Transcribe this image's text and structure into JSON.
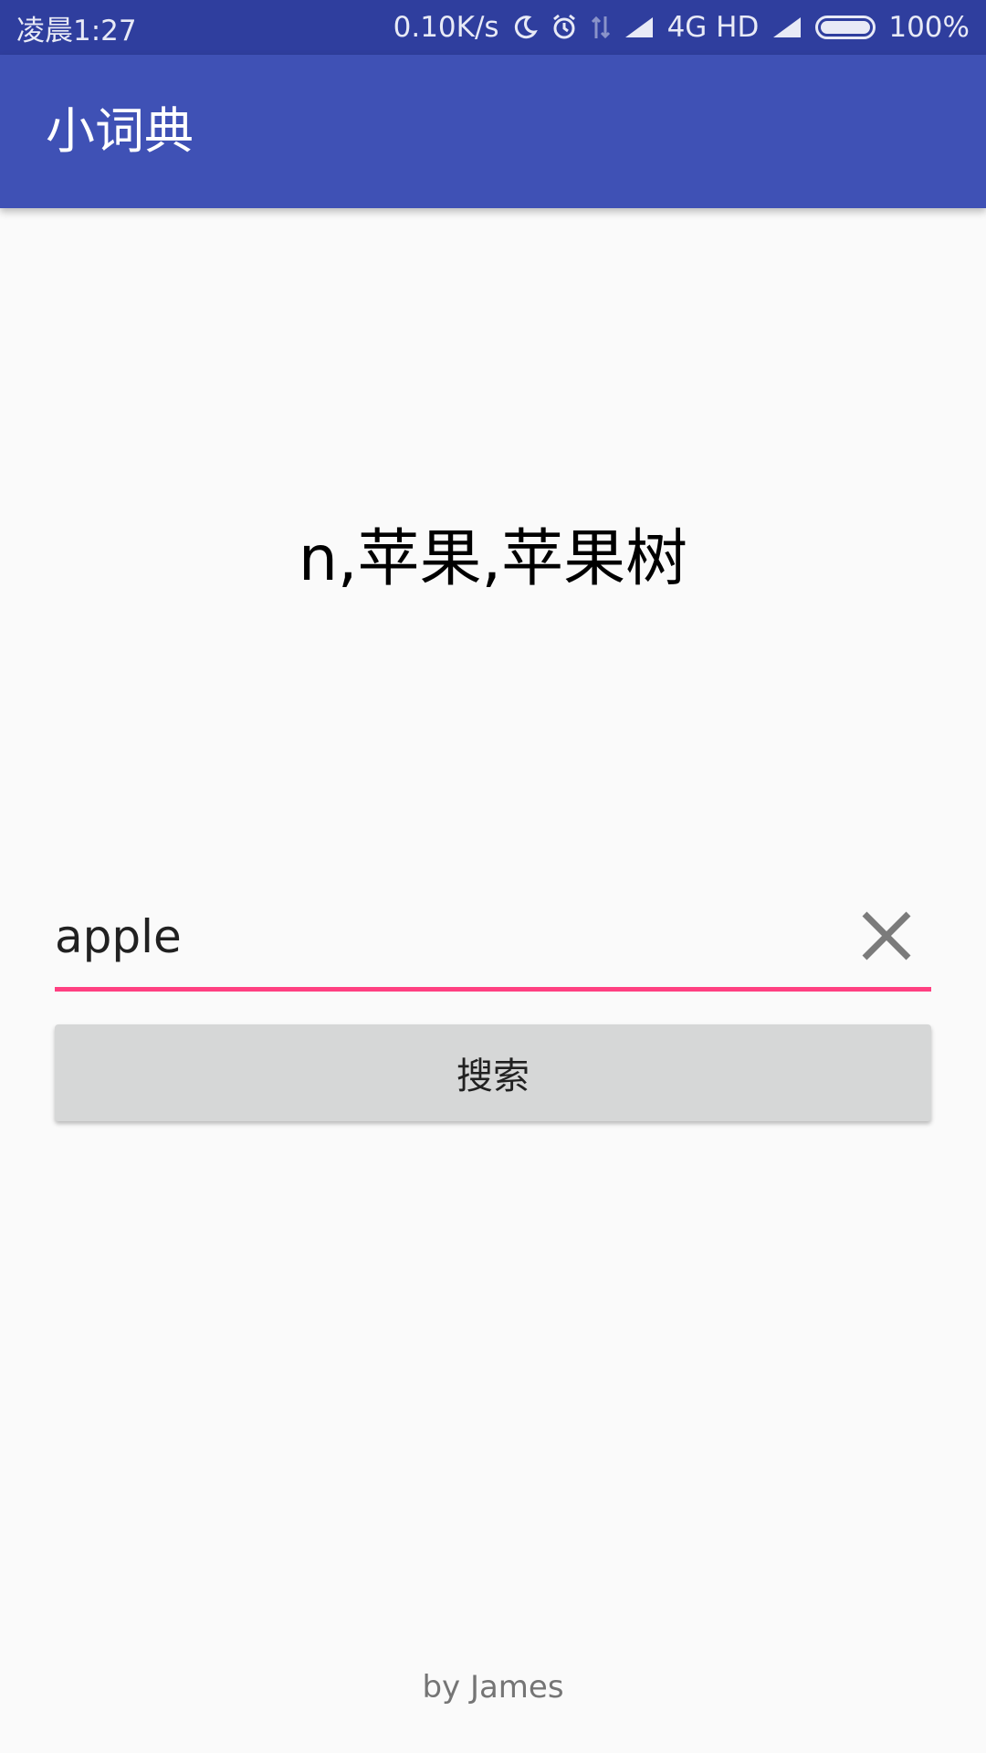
{
  "status_bar": {
    "time": "凌晨1:27",
    "network_speed": "0.10K/s",
    "network_type": "4G HD",
    "battery": "100%",
    "battery_level": 1.0,
    "icons": [
      "moon-icon",
      "alarm-icon",
      "data-arrows-icon",
      "signal-icon",
      "signal-icon",
      "battery-icon"
    ]
  },
  "app_bar": {
    "title": "小词典",
    "color": "#3f51b5"
  },
  "result": {
    "definition": "n,苹果,苹果树"
  },
  "search": {
    "value": "apple",
    "underline_color": "#ff4081",
    "clear_icon": "close-icon",
    "button_label": "搜索"
  },
  "footer": {
    "credit": "by James"
  }
}
